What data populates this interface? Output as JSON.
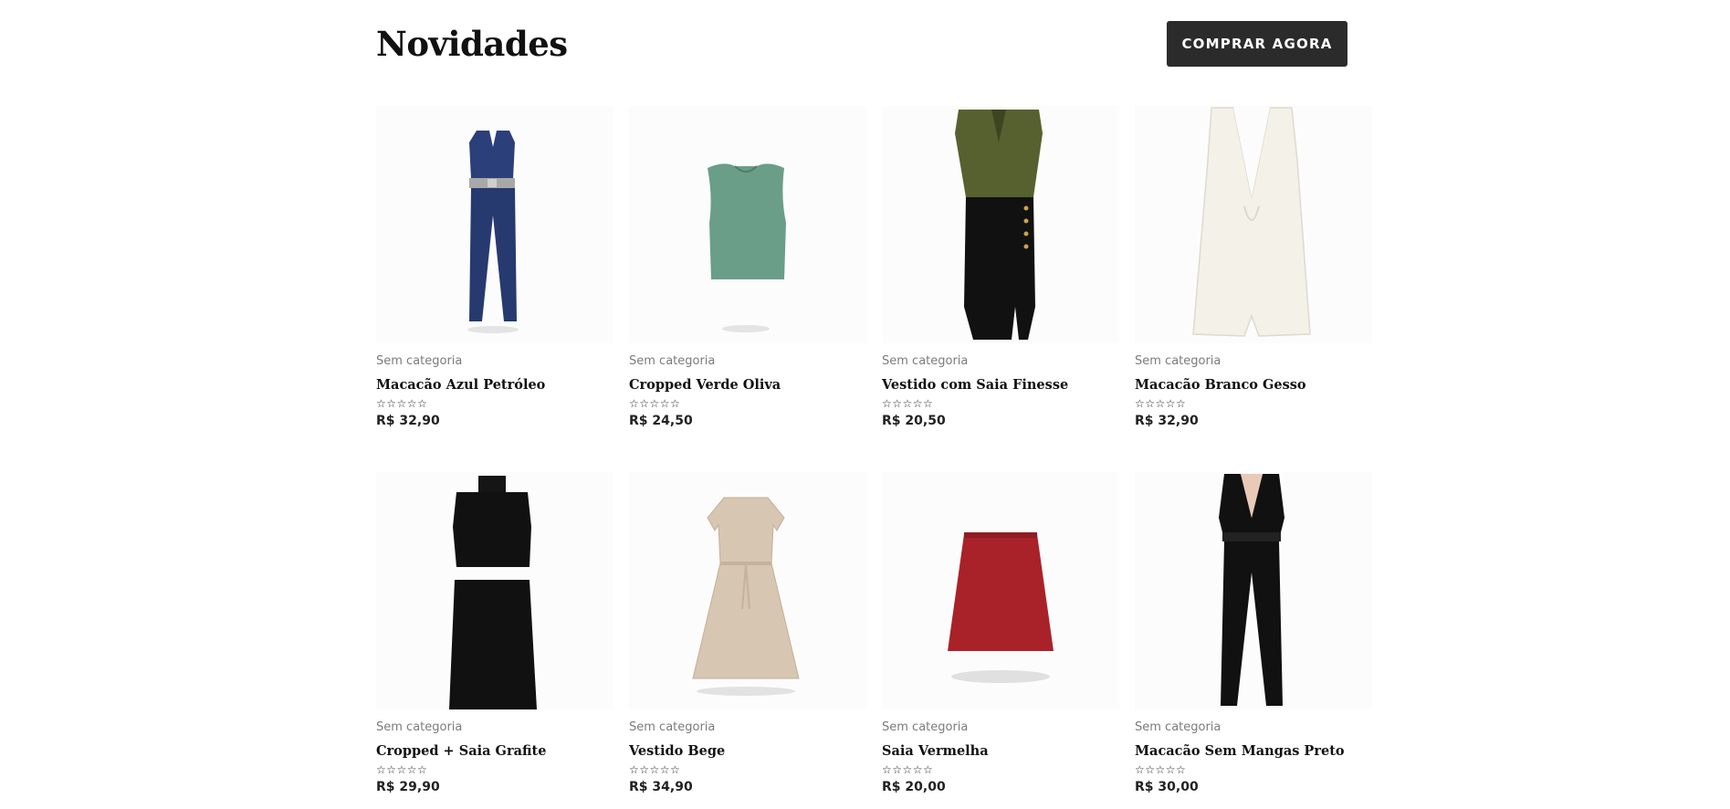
{
  "section": {
    "title": "Novidades",
    "cta_label": "COMPRAR AGORA"
  },
  "products": [
    {
      "category": "Sem categoria",
      "name": "Macacão Azul Petróleo",
      "rating_stars": "☆☆☆☆☆",
      "price": "R$ 32,90",
      "image_icon": "jumpsuit-navy"
    },
    {
      "category": "Sem categoria",
      "name": "Cropped Verde Oliva",
      "rating_stars": "☆☆☆☆☆",
      "price": "R$ 24,50",
      "image_icon": "crop-top-green"
    },
    {
      "category": "Sem categoria",
      "name": "Vestido com Saia Finesse",
      "rating_stars": "☆☆☆☆☆",
      "price": "R$ 20,50",
      "image_icon": "dress-olive-black"
    },
    {
      "category": "Sem categoria",
      "name": "Macacão Branco Gesso",
      "rating_stars": "☆☆☆☆☆",
      "price": "R$ 32,90",
      "image_icon": "romper-white"
    },
    {
      "category": "Sem categoria",
      "name": "Cropped + Saia Grafite",
      "rating_stars": "☆☆☆☆☆",
      "price": "R$ 29,90",
      "image_icon": "two-piece-black"
    },
    {
      "category": "Sem categoria",
      "name": "Vestido Bege",
      "rating_stars": "☆☆☆☆☆",
      "price": "R$ 34,90",
      "image_icon": "dress-beige"
    },
    {
      "category": "Sem categoria",
      "name": "Saia Vermelha",
      "rating_stars": "☆☆☆☆☆",
      "price": "R$ 20,00",
      "image_icon": "skirt-red"
    },
    {
      "category": "Sem categoria",
      "name": "Macacão Sem Mangas Preto",
      "rating_stars": "☆☆☆☆☆",
      "price": "R$ 30,00",
      "image_icon": "jumpsuit-black"
    }
  ]
}
